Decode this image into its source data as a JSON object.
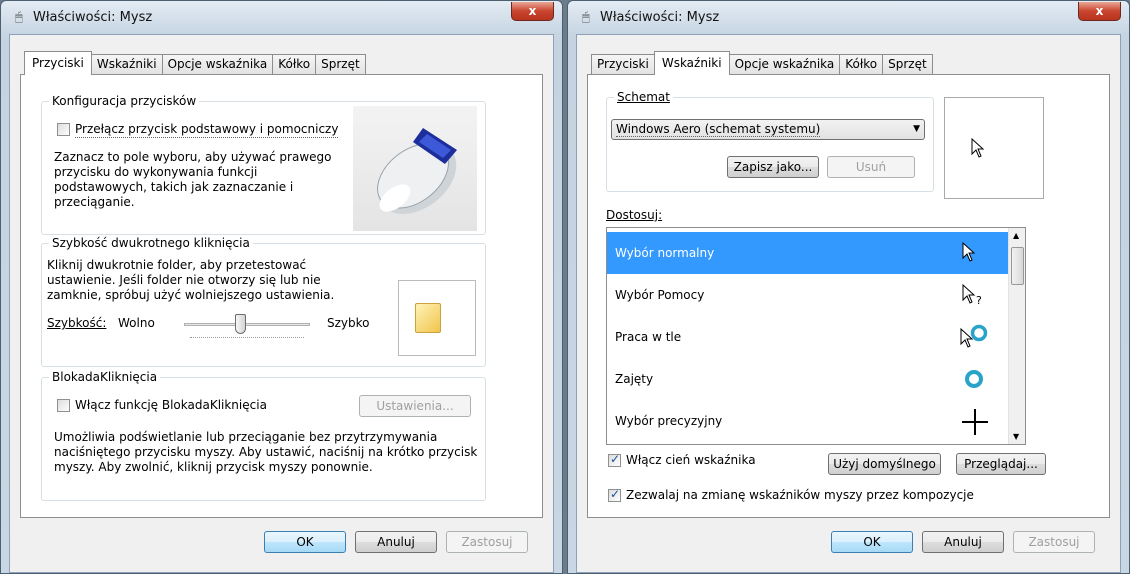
{
  "left": {
    "title": "Właściwości: Mysz",
    "close_label": "x",
    "tabs": [
      "Przyciski",
      "Wskaźniki",
      "Opcje wskaźnika",
      "Kółko",
      "Sprzęt"
    ],
    "buttons_group": {
      "title": "Konfiguracja przycisków",
      "checkbox_label": "Przełącz przycisk podstawowy i pomocniczy",
      "desc": [
        "Zaznacz to pole wyboru, aby używać prawego",
        "przycisku do wykonywania funkcji",
        "podstawowych, takich jak zaznaczanie i",
        "przeciąganie."
      ]
    },
    "dblclick_group": {
      "title": "Szybkość dwukrotnego kliknięcia",
      "desc": [
        "Kliknij dwukrotnie folder, aby przetestować",
        "ustawienie. Jeśli folder nie otworzy się lub nie",
        "zamknie, spróbuj użyć wolniejszego ustawienia."
      ],
      "speed_label": "Szybkość:",
      "slow_label": "Wolno",
      "fast_label": "Szybko",
      "speed_value": 0.44
    },
    "clicklock_group": {
      "title": "BlokadaKliknięcia",
      "checkbox_label": "Włącz funkcję BlokadaKliknięcia",
      "settings_button": "Ustawienia...",
      "desc": [
        "Umożliwia podświetlanie lub przeciąganie bez przytrzymywania",
        "naciśniętego przycisku myszy. Aby ustawić, naciśnij na krótko przycisk",
        "myszy. Aby zwolnić, kliknij przycisk myszy ponownie."
      ]
    },
    "ok": "OK",
    "cancel": "Anuluj",
    "apply": "Zastosuj"
  },
  "right": {
    "title": "Właściwości: Mysz",
    "close_label": "x",
    "tabs": [
      "Przyciski",
      "Wskaźniki",
      "Opcje wskaźnika",
      "Kółko",
      "Sprzęt"
    ],
    "scheme_label": "Schemat",
    "scheme_value": "Windows Aero (schemat systemu)",
    "save_as": "Zapisz jako...",
    "delete": "Usuń",
    "customize_label": "Dostosuj:",
    "cursor_rows": [
      "Wybór normalny",
      "Wybór Pomocy",
      "Praca w tle",
      "Zajęty",
      "Wybór precyzyjny"
    ],
    "shadow_label": "Włącz cień wskaźnika",
    "use_default": "Użyj domyślnego",
    "browse": "Przeglądaj...",
    "allow_themes_label": "Zezwalaj na zmianę wskaźników myszy przez kompozycje",
    "ok": "OK",
    "cancel": "Anuluj",
    "apply": "Zastosuj"
  }
}
